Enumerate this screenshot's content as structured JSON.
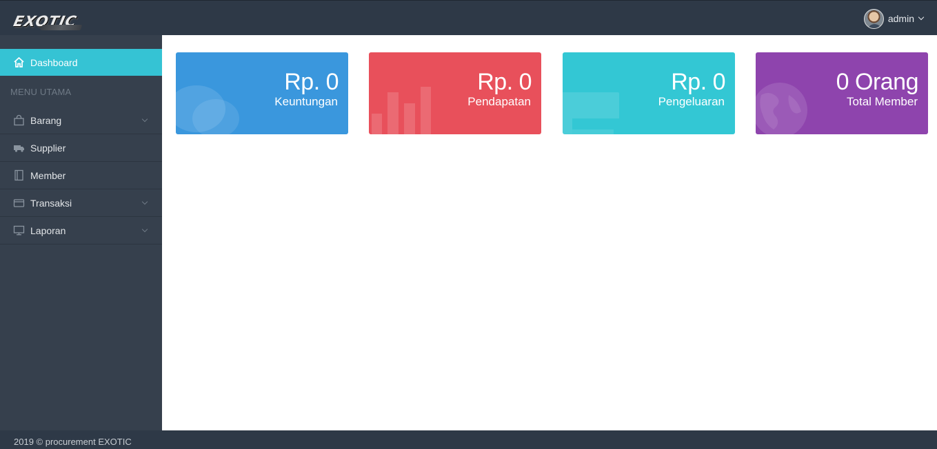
{
  "brand": {
    "logo_text": "EXOTIC"
  },
  "header": {
    "username": "admin"
  },
  "sidebar": {
    "menu_header": "MENU UTAMA",
    "items": [
      {
        "label": "Dashboard",
        "icon": "home-icon",
        "active": true
      },
      {
        "label": "Barang",
        "icon": "shopping-bag-icon",
        "has_submenu": true
      },
      {
        "label": "Supplier",
        "icon": "truck-icon",
        "has_submenu": false
      },
      {
        "label": "Member",
        "icon": "address-book-icon",
        "has_submenu": false
      },
      {
        "label": "Transaksi",
        "icon": "wallet-icon",
        "has_submenu": true
      },
      {
        "label": "Laporan",
        "icon": "monitor-icon",
        "has_submenu": true
      }
    ]
  },
  "cards": [
    {
      "value": "Rp. 0",
      "label": "Keuntungan",
      "color": "#3a97dd",
      "icon": "comments-icon"
    },
    {
      "value": "Rp. 0",
      "label": "Pendapatan",
      "color": "#e8505b",
      "icon": "bar-chart-icon"
    },
    {
      "value": "Rp. 0",
      "label": "Pengeluaran",
      "color": "#33c7d4",
      "icon": "money-icon"
    },
    {
      "value": "0 Orang",
      "label": "Total Member",
      "color": "#8e44ad",
      "icon": "globe-icon"
    }
  ],
  "footer": {
    "text": "2019 © procurement EXOTIC"
  }
}
